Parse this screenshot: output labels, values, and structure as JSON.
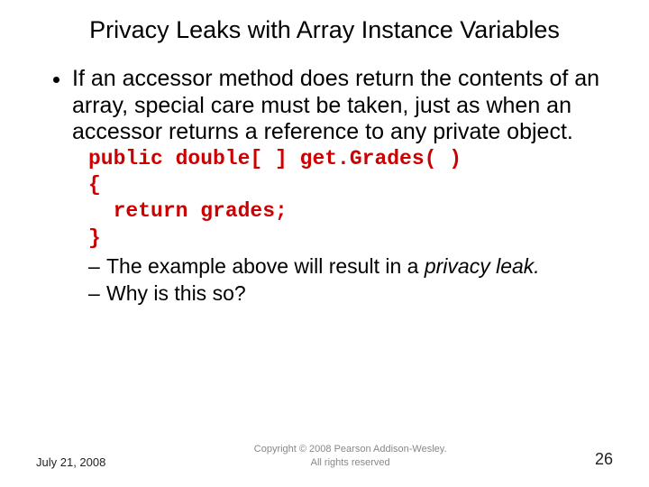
{
  "title": "Privacy Leaks with Array Instance Variables",
  "bullet1": "If an accessor method does return the contents of an array, special care must be taken, just as when an accessor returns a reference to any private object.",
  "code": {
    "line1": "public double[ ] get.Grades( )",
    "line2": "{",
    "line3": "  return grades;",
    "line4": "}"
  },
  "sub1_prefix": "The example above will result in a ",
  "sub1_italic": "privacy leak.",
  "sub2": "Why is this so?",
  "footer": {
    "date": "July 21, 2008",
    "copyright_line1": "Copyright © 2008 Pearson Addison-Wesley.",
    "copyright_line2": "All rights reserved",
    "page": "26"
  }
}
